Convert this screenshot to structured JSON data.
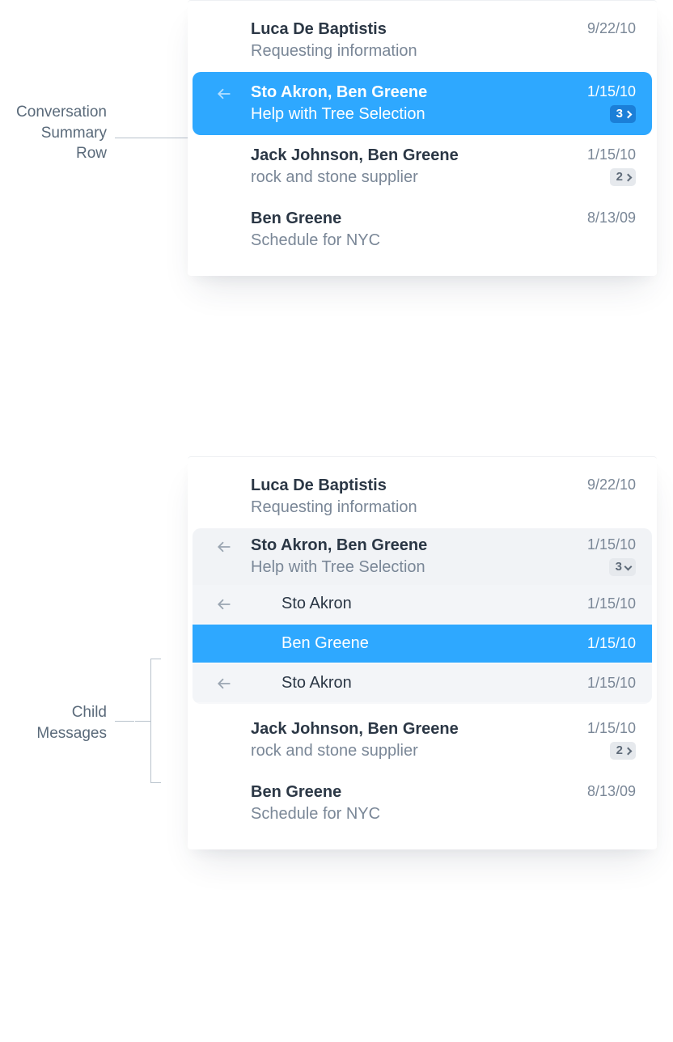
{
  "annotations": {
    "summary_row_label": "Conversation\nSummary\nRow",
    "child_messages_label": "Child\nMessages"
  },
  "panel_top": {
    "rows": [
      {
        "sender": "Luca De Baptistis",
        "date": "9/22/10",
        "subject": "Requesting information"
      },
      {
        "sender": "Sto Akron, Ben Greene",
        "date": "1/15/10",
        "subject": "Help with Tree Selection",
        "badge": "3",
        "reply": true,
        "selected": true
      },
      {
        "sender": "Jack Johnson, Ben Greene",
        "date": "1/15/10",
        "subject": "rock and stone supplier",
        "badge": "2"
      },
      {
        "sender": "Ben Greene",
        "date": "8/13/09",
        "subject": "Schedule for NYC"
      }
    ]
  },
  "panel_bottom": {
    "rows": [
      {
        "sender": "Luca De Baptistis",
        "date": "9/22/10",
        "subject": "Requesting information"
      },
      {
        "sender": "Sto Akron, Ben Greene",
        "date": "1/15/10",
        "subject": "Help with Tree Selection",
        "badge": "3",
        "reply": true,
        "expanded": true
      },
      {
        "sender": "Jack Johnson, Ben Greene",
        "date": "1/15/10",
        "subject": "rock and stone supplier",
        "badge": "2"
      },
      {
        "sender": "Ben Greene",
        "date": "8/13/09",
        "subject": "Schedule for NYC"
      }
    ],
    "children": [
      {
        "name": "Sto Akron",
        "date": "1/15/10",
        "reply": true
      },
      {
        "name": "Ben Greene",
        "date": "1/15/10",
        "selected": true
      },
      {
        "name": "Sto Akron",
        "date": "1/15/10",
        "reply": true
      }
    ]
  }
}
